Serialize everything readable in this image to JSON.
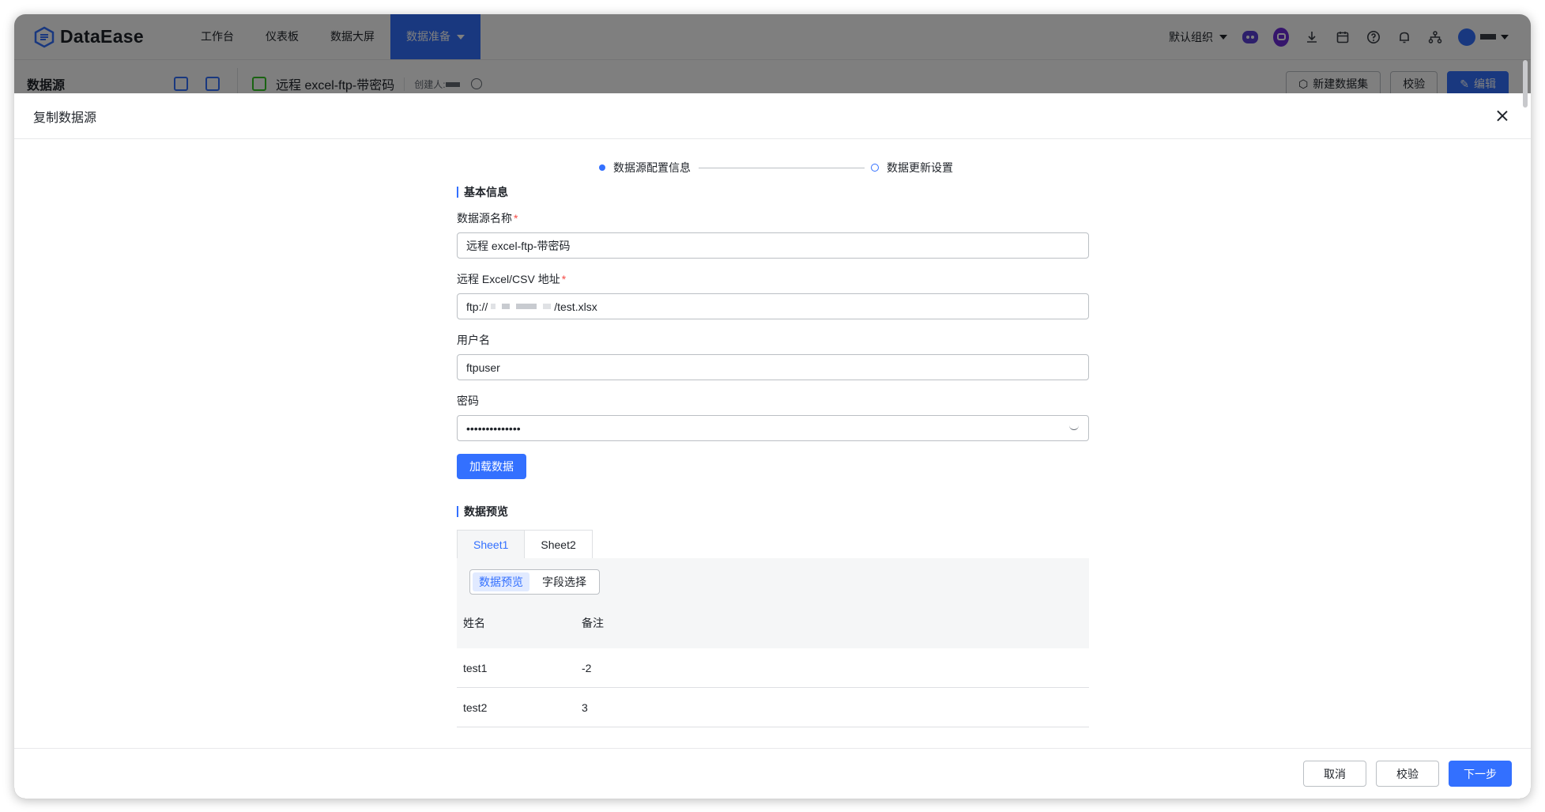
{
  "app": {
    "name": "DataEase"
  },
  "nav": {
    "items": [
      {
        "label": "工作台"
      },
      {
        "label": "仪表板"
      },
      {
        "label": "数据大屏"
      },
      {
        "label": "数据准备"
      }
    ]
  },
  "topbar": {
    "org_label": "默认组织"
  },
  "subbar": {
    "title": "数据源",
    "ds_name": "远程 excel-ftp-带密码",
    "creator_label": "创建人:",
    "new_dataset_label": "新建数据集",
    "verify_label": "校验",
    "edit_label": "编辑"
  },
  "drawer": {
    "title": "复制数据源",
    "steps": [
      {
        "label": "数据源配置信息"
      },
      {
        "label": "数据更新设置"
      }
    ],
    "basic_section": "基本信息",
    "fields": {
      "name_label": "数据源名称",
      "name_value": "远程 excel-ftp-带密码",
      "url_label": "远程 Excel/CSV 地址",
      "url_prefix": "ftp://",
      "url_suffix": "/test.xlsx",
      "user_label": "用户名",
      "user_value": "ftpuser",
      "pwd_label": "密码",
      "pwd_value": "••••••••••••••"
    },
    "load_button": "加载数据",
    "preview_section": "数据预览",
    "sheets": [
      {
        "label": "Sheet1"
      },
      {
        "label": "Sheet2"
      }
    ],
    "segments": [
      {
        "label": "数据预览"
      },
      {
        "label": "字段选择"
      }
    ],
    "table": {
      "headers": [
        "姓名",
        "备注"
      ],
      "rows": [
        [
          "test1",
          "-2"
        ],
        [
          "test2",
          "3"
        ]
      ]
    },
    "footer": {
      "cancel": "取消",
      "verify": "校验",
      "next": "下一步"
    }
  },
  "colors": {
    "accent": "#3370ff",
    "required": "#f54a45"
  }
}
